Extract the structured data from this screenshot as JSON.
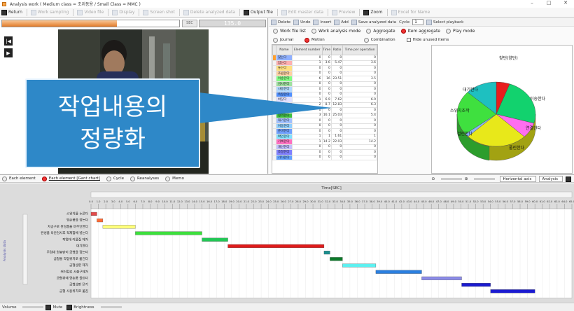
{
  "window": {
    "title": "Analysis work ( Medium class = 조위동용 / Small Class = MMC )",
    "controls": [
      "–",
      "□",
      "✕"
    ]
  },
  "menubar": [
    {
      "label": "Return",
      "enabled": true,
      "icon": "return-icon"
    },
    {
      "label": "Work sampling",
      "enabled": false,
      "icon": "work-sampling-icon"
    },
    {
      "label": "Video file",
      "enabled": false,
      "icon": "video-file-icon"
    },
    {
      "label": "Display",
      "enabled": false,
      "icon": "display-icon"
    },
    {
      "label": "Screen shot",
      "enabled": false,
      "icon": "screenshot-icon"
    },
    {
      "label": "Delete analyzed data",
      "enabled": false,
      "icon": "delete-icon"
    },
    {
      "label": "Output file",
      "enabled": true,
      "icon": "output-file-icon"
    },
    {
      "label": "Edit master data",
      "enabled": false,
      "icon": "edit-master-icon"
    },
    {
      "label": "Preview",
      "enabled": false,
      "icon": "preview-icon"
    },
    {
      "label": "Zoom",
      "enabled": true,
      "icon": "zoom-icon"
    },
    {
      "label": "Excel for Name",
      "enabled": false,
      "icon": "excel-icon"
    }
  ],
  "video": {
    "sec_label": "SEC",
    "time": "135.0",
    "progress": 0.65,
    "play_prev": "|◀",
    "play": "▶"
  },
  "callout": {
    "line1": "작업내용의",
    "line2": "정량화"
  },
  "right_toolbar": {
    "delete": "Delete",
    "undo": "Undo",
    "insert": "Insert",
    "add": "Add",
    "save": "Save analyzed data",
    "cycle_label": "Cycle",
    "cycle_value": "1",
    "playback": "Select playback"
  },
  "modes": [
    {
      "label": "Work file list",
      "on": false
    },
    {
      "label": "Work analysis mode",
      "on": false
    },
    {
      "label": "Aggregate",
      "on": false
    },
    {
      "label": "Item aggregate",
      "on": true
    },
    {
      "label": "Play mode",
      "on": false
    }
  ],
  "submodes": {
    "journal": "Journal",
    "motion": "Motion",
    "combination": "Combination",
    "hide_unused": "Hide unused items"
  },
  "table": {
    "headers": [
      "Name",
      "Element number",
      "Time",
      "Ratio",
      "Time per operation"
    ],
    "rows": [
      {
        "name": "찾는다",
        "color": "#8fb0ff",
        "num": "0",
        "time": "0",
        "ratio": "0",
        "per": "0"
      },
      {
        "name": "잡는다",
        "color": "#ffb0b0",
        "num": "1",
        "time": "3.6",
        "ratio": "5.47",
        "per": "3.6"
      },
      {
        "name": "놓는다",
        "color": "#ffe080",
        "num": "0",
        "time": "0",
        "ratio": "0",
        "per": "0"
      },
      {
        "name": "조립한다",
        "color": "#ffd0a0",
        "num": "0",
        "time": "0",
        "ratio": "0",
        "per": "0"
      },
      {
        "name": "이송한다",
        "color": "#80ff80",
        "num": "6",
        "time": "16",
        "ratio": "23.51",
        "per": "3.5"
      },
      {
        "name": "검사한다",
        "color": "#a0e0a0",
        "num": "0",
        "time": "0",
        "ratio": "0",
        "per": "0"
      },
      {
        "name": "사용한다",
        "color": "#b0d8ff",
        "num": "0",
        "time": "0",
        "ratio": "0",
        "per": "0"
      },
      {
        "name": "측정한다",
        "color": "#5090ff",
        "num": "0",
        "time": "0",
        "ratio": "0",
        "per": "0"
      },
      {
        "name": "바꾼다",
        "color": "#e0e0ff",
        "num": "1",
        "time": "6.9",
        "ratio": "7.62",
        "per": "6.9"
      },
      {
        "name": "분리한다",
        "color": "#ff7070",
        "num": "2",
        "time": "8.7",
        "ratio": "12.83",
        "per": "6.3"
      },
      {
        "name": "세척한다",
        "color": "#70e0a0",
        "num": "0",
        "time": "0",
        "ratio": "0",
        "per": "0"
      },
      {
        "name": "정리한다",
        "color": "#40c040",
        "num": "3",
        "time": "16.1",
        "ratio": "25.03",
        "per": "5.4"
      },
      {
        "name": "대기한다",
        "color": "#a0c0ff",
        "num": "0",
        "time": "0",
        "ratio": "0",
        "per": "0"
      },
      {
        "name": "이동한다",
        "color": "#90d0ff",
        "num": "0",
        "time": "0",
        "ratio": "0",
        "per": "0"
      },
      {
        "name": "준비한다",
        "color": "#70a0ff",
        "num": "0",
        "time": "0",
        "ratio": "0",
        "per": "0"
      },
      {
        "name": "확인한다",
        "color": "#80e0ff",
        "num": "1",
        "time": "1",
        "ratio": "1.61",
        "per": "1"
      },
      {
        "name": "기록한다",
        "color": "#ff70c0",
        "num": "1",
        "time": "14.2",
        "ratio": "22.03",
        "per": "14.2"
      },
      {
        "name": "개선한다",
        "color": "#c0c0ff",
        "num": "0",
        "time": "0",
        "ratio": "0",
        "per": "0"
      },
      {
        "name": "조정한다",
        "color": "#8080ff",
        "num": "0",
        "time": "0",
        "ratio": "0",
        "per": "0"
      },
      {
        "name": "기타한다",
        "color": "#60a0ff",
        "num": "0",
        "time": "0",
        "ratio": "0",
        "per": "0"
      }
    ]
  },
  "pie": {
    "slices": [
      {
        "label": "잡는다",
        "value": 5.47,
        "color": "#e81d1d"
      },
      {
        "label": "이송한다",
        "value": 23.51,
        "color": "#12d26e"
      },
      {
        "label": "바꾼다",
        "value": 7.62,
        "color": "#ff6ef0"
      },
      {
        "label": "정리한다",
        "value": 25.03,
        "color": "#e8e81a"
      },
      {
        "label": "확인한다",
        "value": 1.61,
        "color": "#8ab4ff"
      },
      {
        "label": "기록한다",
        "value": 22.03,
        "color": "#3fe03f"
      },
      {
        "label": "분리한다",
        "value": 12.83,
        "color": "#1ec0c0"
      }
    ],
    "labels": [
      "찾던(양단)",
      "이송한다",
      "대기한다",
      "스위치조작",
      "연결한다",
      "걸린한다",
      "풀린한다"
    ]
  },
  "lower_tabs": [
    {
      "label": "Each element",
      "on": false
    },
    {
      "label": "Each element [Gant chart]",
      "on": true
    },
    {
      "label": "Cycle",
      "on": false
    },
    {
      "label": "Reanalyses",
      "on": false
    },
    {
      "label": "Memo",
      "on": false
    }
  ],
  "zoom": {
    "horizontal_axis": "Horizontal axis",
    "analysis": "Analysis"
  },
  "chart_data": {
    "type": "gantt",
    "title": "Time[SEC]",
    "ylabel": "Analysis data",
    "x_ticks": [
      "0.0",
      "1.0",
      "2.0",
      "3.0",
      "4.0",
      "5.0",
      "6.0",
      "7.0",
      "8.0",
      "9.0",
      "10.0",
      "11.0",
      "12.0",
      "13.0",
      "14.0",
      "15.0",
      "16.0",
      "17.0",
      "18.0",
      "19.0",
      "20.0",
      "21.0",
      "22.0",
      "23.0",
      "24.0",
      "25.0",
      "26.0",
      "27.0",
      "28.0",
      "29.0",
      "30.0",
      "31.0",
      "32.0",
      "33.0",
      "34.0",
      "35.0",
      "36.0",
      "37.0",
      "38.0",
      "39.0",
      "40.0",
      "41.0",
      "42.0",
      "43.0",
      "44.0",
      "45.0",
      "46.0",
      "47.0",
      "48.0",
      "49.0",
      "50.0",
      "51.0",
      "52.0",
      "53.0",
      "54.0",
      "55.0",
      "56.0",
      "57.0",
      "58.0",
      "59.0",
      "60.0",
      "61.0",
      "62.0",
      "63.0",
      "64.0",
      "65.0"
    ],
    "xlim": [
      0,
      65
    ],
    "tasks": [
      {
        "name": "스위치를 누른다",
        "start": 0.0,
        "end": 0.8,
        "color": "#e24a4a"
      },
      {
        "name": "양손품을 잡는다",
        "start": 0.8,
        "end": 1.6,
        "color": "#ff6b35"
      },
      {
        "name": "지공구로 완성품을 마주인한다",
        "start": 1.6,
        "end": 6.0,
        "color": "#ffff7a"
      },
      {
        "name": "완성품 육안검사후 적재함에 넣는다",
        "start": 6.0,
        "end": 15.0,
        "color": "#3ce03c"
      },
      {
        "name": "작업대 이물질 제거",
        "start": 15.0,
        "end": 18.5,
        "color": "#22c655"
      },
      {
        "name": "대기한다",
        "start": 18.5,
        "end": 31.5,
        "color": "#e01b1b"
      },
      {
        "name": "주입대 원료탄이 금형을 잡는다",
        "start": 31.5,
        "end": 32.3,
        "color": "#1a8f8f"
      },
      {
        "name": "금형을 작업위치로 옮긴다",
        "start": 32.3,
        "end": 34.0,
        "color": "#0c7a2a"
      },
      {
        "name": "금형상판 제거",
        "start": 34.0,
        "end": 38.5,
        "color": "#5cf0f0"
      },
      {
        "name": "커터칼로 사출구제거",
        "start": 38.5,
        "end": 44.7,
        "color": "#2a7fe0"
      },
      {
        "name": "금형위에 양손품 올린다",
        "start": 44.7,
        "end": 50.1,
        "color": "#8c8ce8"
      },
      {
        "name": "금형상판 닫기",
        "start": 50.1,
        "end": 54.0,
        "color": "#1b1bd0"
      },
      {
        "name": "금형 사용위치로 옮김",
        "start": 54.0,
        "end": 60.0,
        "color": "#1b1bd0"
      }
    ]
  },
  "status": {
    "volume": "Volume",
    "mute": "Mute",
    "brightness": "Brightness"
  }
}
